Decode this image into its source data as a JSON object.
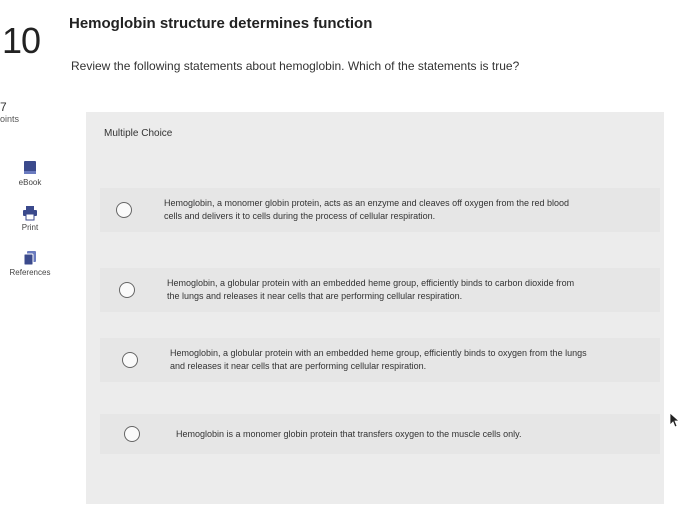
{
  "question": {
    "number": "10",
    "points_value": "7",
    "points_label": "oints",
    "title": "Hemoglobin structure determines function",
    "prompt": "Review the following statements about hemoglobin. Which of the statements is true?",
    "type_label": "Multiple Choice"
  },
  "sidebar": {
    "tools": [
      {
        "label": "eBook",
        "icon": "book-icon"
      },
      {
        "label": "Print",
        "icon": "printer-icon"
      },
      {
        "label": "References",
        "icon": "references-icon"
      }
    ]
  },
  "options": [
    {
      "text": "Hemoglobin, a monomer globin protein, acts as an enzyme and cleaves off oxygen from the red blood cells and delivers it to cells during the process of cellular respiration."
    },
    {
      "text": "Hemoglobin, a globular protein with an embedded heme group, efficiently binds to carbon dioxide from the lungs and releases it near cells that are performing cellular respiration."
    },
    {
      "text": "Hemoglobin, a globular protein with an embedded heme group, efficiently binds to oxygen from the lungs and releases it near cells that are performing cellular respiration."
    },
    {
      "text": "Hemoglobin is a monomer globin protein that transfers oxygen to the muscle cells only."
    }
  ],
  "colors": {
    "accent": "#3b4a8c",
    "panel": "#ececec"
  }
}
